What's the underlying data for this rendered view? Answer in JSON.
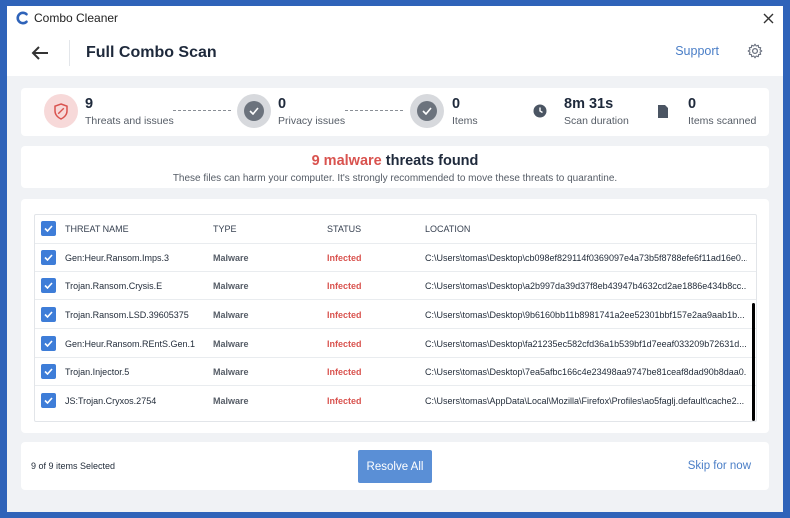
{
  "app": {
    "title": "Combo Cleaner"
  },
  "header": {
    "title": "Full Combo Scan",
    "support_label": "Support"
  },
  "stats": [
    {
      "value": "9",
      "label": "Threats and issues"
    },
    {
      "value": "0",
      "label": "Privacy issues"
    },
    {
      "value": "0",
      "label": "Items"
    },
    {
      "value": "8m 31s",
      "label": "Scan duration"
    },
    {
      "value": "0",
      "label": "Items scanned"
    }
  ],
  "summary": {
    "highlight": "9 malware",
    "title_rest": " threats found",
    "subtitle": "These files can harm your computer. It's strongly recommended to move these threats to quarantine."
  },
  "table": {
    "columns": {
      "name": "THREAT NAME",
      "type": "TYPE",
      "status": "STATUS",
      "location": "LOCATION"
    },
    "rows": [
      {
        "name": "Gen:Heur.Ransom.Imps.3",
        "type": "Malware",
        "status": "Infected",
        "location": "C:\\Users\\tomas\\Desktop\\cb098ef829114f0369097e4a73b5f8788efe6f11ad16e0..."
      },
      {
        "name": "Trojan.Ransom.Crysis.E",
        "type": "Malware",
        "status": "Infected",
        "location": "C:\\Users\\tomas\\Desktop\\a2b997da39d37f8eb43947b4632cd2ae1886e434b8cc..."
      },
      {
        "name": "Trojan.Ransom.LSD.39605375",
        "type": "Malware",
        "status": "Infected",
        "location": "C:\\Users\\tomas\\Desktop\\9b6160bb11b8981741a2ee52301bbf157e2aa9aab1b..."
      },
      {
        "name": "Gen:Heur.Ransom.REntS.Gen.1",
        "type": "Malware",
        "status": "Infected",
        "location": "C:\\Users\\tomas\\Desktop\\fa21235ec582cfd36a1b539bf1d7eeaf033209b72631d..."
      },
      {
        "name": "Trojan.Injector.5",
        "type": "Malware",
        "status": "Infected",
        "location": "C:\\Users\\tomas\\Desktop\\7ea5afbc166c4e23498aa9747be81ceaf8dad90b8daa0..."
      },
      {
        "name": "JS:Trojan.Cryxos.2754",
        "type": "Malware",
        "status": "Infected",
        "location": "C:\\Users\\tomas\\AppData\\Local\\Mozilla\\Firefox\\Profiles\\ao5faglj.default\\cache2..."
      }
    ]
  },
  "footer": {
    "selected_text": "9 of 9 items Selected",
    "resolve_label": "Resolve All",
    "skip_label": "Skip for now"
  },
  "colors": {
    "accent": "#3e7dd8",
    "danger": "#d9534f",
    "link": "#4a7ec7",
    "frame": "#2f63b9"
  },
  "icons": {
    "logo": "combo-cleaner-logo-icon",
    "close": "close-icon",
    "back": "back-arrow-icon",
    "settings": "gear-icon",
    "threats": "shield-icon",
    "privacy": "check-circle-icon",
    "items": "check-circle-icon",
    "duration": "clock-icon",
    "scanned": "document-icon",
    "checkbox": "checkmark-icon"
  }
}
